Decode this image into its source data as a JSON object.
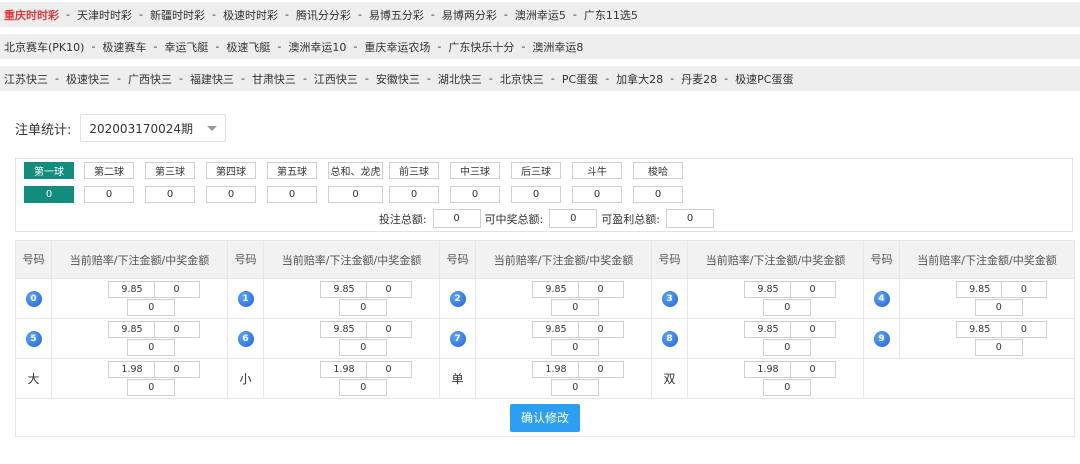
{
  "nav": {
    "rows": [
      [
        "重庆时时彩",
        "天津时时彩",
        "新疆时时彩",
        "极速时时彩",
        "腾讯分分彩",
        "易博五分彩",
        "易博两分彩",
        "澳洲幸运5",
        "广东11选5"
      ],
      [
        "北京赛车(PK10)",
        "极速赛车",
        "幸运飞艇",
        "极速飞艇",
        "澳洲幸运10",
        "重庆幸运农场",
        "广东快乐十分",
        "澳洲幸运8"
      ],
      [
        "江苏快三",
        "极速快三",
        "广西快三",
        "福建快三",
        "甘肃快三",
        "江西快三",
        "安徽快三",
        "湖北快三",
        "北京快三",
        "PC蛋蛋",
        "加拿大28",
        "丹麦28",
        "极速PC蛋蛋"
      ]
    ],
    "active": "重庆时时彩",
    "separator": "-"
  },
  "stats": {
    "label": "注单统计:",
    "period": "202003170024期"
  },
  "tabs": [
    {
      "label": "第一球",
      "value": "0",
      "active": true
    },
    {
      "label": "第二球",
      "value": "0"
    },
    {
      "label": "第三球",
      "value": "0"
    },
    {
      "label": "第四球",
      "value": "0"
    },
    {
      "label": "第五球",
      "value": "0"
    },
    {
      "label": "总和、龙虎",
      "value": "0"
    },
    {
      "label": "前三球",
      "value": "0"
    },
    {
      "label": "中三球",
      "value": "0"
    },
    {
      "label": "后三球",
      "value": "0"
    },
    {
      "label": "斗牛",
      "value": "0"
    },
    {
      "label": "梭哈",
      "value": "0"
    }
  ],
  "totals": {
    "bet_label": "投注总额:",
    "bet_value": "0",
    "win_label": "可中奖总额:",
    "win_value": "0",
    "profit_label": "可盈利总额:",
    "profit_value": "0"
  },
  "table": {
    "col_no": "号码",
    "col_info": "当前赔率/下注金额/中奖金额",
    "rows": [
      [
        {
          "ball": "0",
          "odds": "9.85",
          "amount": "0",
          "win": "0"
        },
        {
          "ball": "1",
          "odds": "9.85",
          "amount": "0",
          "win": "0"
        },
        {
          "ball": "2",
          "odds": "9.85",
          "amount": "0",
          "win": "0"
        },
        {
          "ball": "3",
          "odds": "9.85",
          "amount": "0",
          "win": "0"
        },
        {
          "ball": "4",
          "odds": "9.85",
          "amount": "0",
          "win": "0"
        }
      ],
      [
        {
          "ball": "5",
          "odds": "9.85",
          "amount": "0",
          "win": "0"
        },
        {
          "ball": "6",
          "odds": "9.85",
          "amount": "0",
          "win": "0"
        },
        {
          "ball": "7",
          "odds": "9.85",
          "amount": "0",
          "win": "0"
        },
        {
          "ball": "8",
          "odds": "9.85",
          "amount": "0",
          "win": "0"
        },
        {
          "ball": "9",
          "odds": "9.85",
          "amount": "0",
          "win": "0"
        }
      ],
      [
        {
          "label": "大",
          "odds": "1.98",
          "amount": "0",
          "win": "0"
        },
        {
          "label": "小",
          "odds": "1.98",
          "amount": "0",
          "win": "0"
        },
        {
          "label": "单",
          "odds": "1.98",
          "amount": "0",
          "win": "0"
        },
        {
          "label": "双",
          "odds": "1.98",
          "amount": "0",
          "win": "0"
        }
      ]
    ]
  },
  "confirm_label": "确认修改",
  "colors": {
    "active_nav": "#e4393c",
    "tab_active": "#118c7d",
    "ball": "#1d63d6",
    "button": "#2d9ff2"
  }
}
